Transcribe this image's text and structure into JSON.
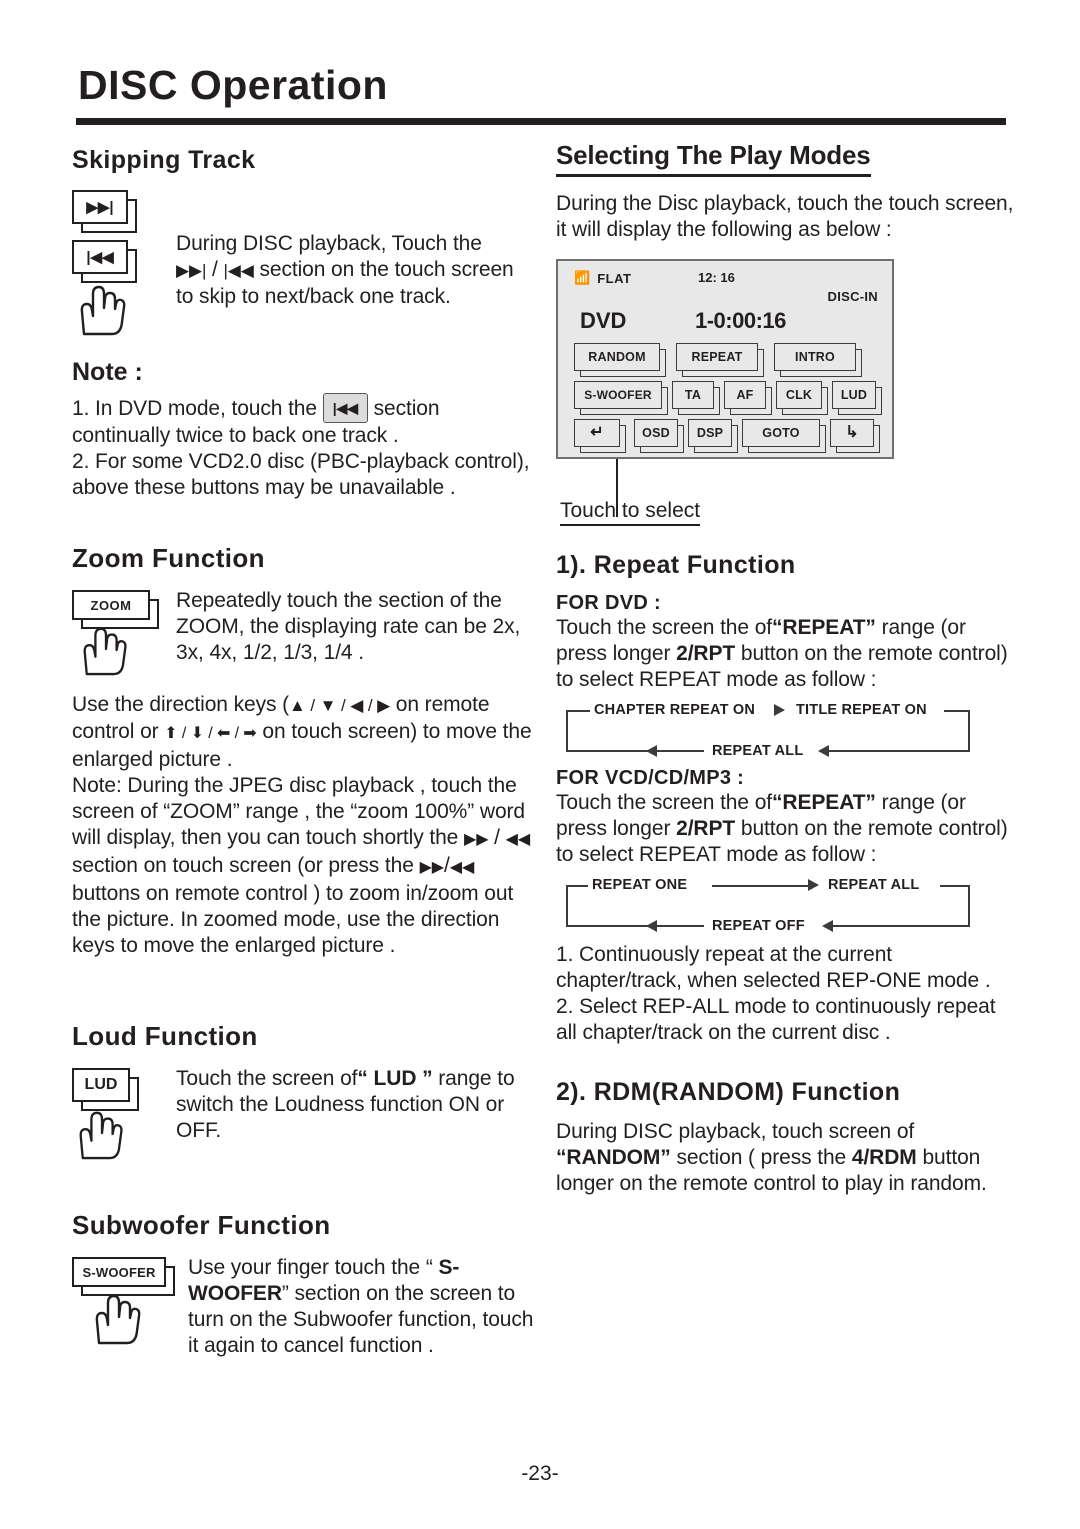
{
  "page": {
    "title": "DISC Operation",
    "number": "-23-"
  },
  "left": {
    "skipping": {
      "heading": "Skipping Track",
      "icon_next": "next-track-icon",
      "icon_prev": "previous-track-icon",
      "icon_hand": "hand-pointer-icon",
      "text_line1": "During DISC playback, Touch the",
      "text_line2_pre": "",
      "next_glyph": "▶▶|",
      "prev_glyph": "|◀◀",
      "text_line2_mid": " / ",
      "text_line2_post": " section on the touch screen",
      "text_line3": "to skip to next/back one track."
    },
    "note": {
      "heading": "Note :",
      "item1_pre": "1. In DVD mode, touch the",
      "item1_button": "prev-track-button",
      "item1_post": "section",
      "item1_cont": "continually twice to back one track .",
      "item2": "2. For some VCD2.0 disc (PBC-playback control), above these buttons may be unavailable ."
    },
    "zoom": {
      "heading": "Zoom Function",
      "key_label": "ZOOM",
      "text1": "Repeatedly touch the section of the ZOOM, the displaying rate can be 2x, 3x, 4x, 1/2, 1/3, 1/4 .",
      "text2_a": "Use the direction keys (",
      "remote_keys": "▲ / ▼ / ◀ / ▶",
      "text2_b": " on remote control or ",
      "touch_keys": "⬆ / ⬇ / ⬅ / ➡",
      "text2_c": " on touch screen) to move the enlarged picture .",
      "text3_a": "Note: During the JPEG disc playback , touch the screen of  “ZOOM” range , the “zoom 100%”  word will display, then you can touch shortly  the ",
      "ff_glyph": "▶▶",
      "rew_glyph": "◀◀",
      "text3_b": " section on touch screen (or press the ",
      "text3_c": " buttons on remote control )  to zoom in/zoom out the picture. In zoomed mode, use the direction keys to move the enlarged picture ."
    },
    "loud": {
      "heading": "Loud Function",
      "key_label": "LUD",
      "text_a": "Touch the screen of",
      "text_b": "“ LUD ”",
      "text_c": " range to switch the Loudness function ON or OFF."
    },
    "subwoofer": {
      "heading": "Subwoofer Function",
      "key_label": "S-WOOFER",
      "text_a": "Use your finger touch the “ ",
      "text_b": "S-WOOFER",
      "text_c": "” section on the screen to turn on the Subwoofer function, touch it again to cancel function ."
    }
  },
  "right": {
    "heading": "Selecting The Play Modes",
    "intro": "During the Disc playback, touch the touch screen, it will display the following as below :",
    "device": {
      "bluetooth_icon": "bluetooth-icon",
      "eq_mode": "FLAT",
      "clock": "12: 16",
      "disc_status": "DISC-IN",
      "source": "DVD",
      "time": "1-0:00:16",
      "row1": [
        "RANDOM",
        "REPEAT",
        "INTRO"
      ],
      "row2": [
        "S-WOOFER",
        "TA",
        "AF",
        "CLK",
        "LUD"
      ],
      "row3": [
        "↵",
        "OSD",
        "DSP",
        "GOTO",
        "↳"
      ]
    },
    "callout": "Touch to select",
    "repeat": {
      "heading": "1). Repeat Function",
      "dvd_label": "FOR  DVD :",
      "dvd_text_a": "Touch the screen the of",
      "dvd_text_b": "“REPEAT”",
      "dvd_text_c": " range (or press longer ",
      "dvd_text_d": "2/RPT",
      "dvd_text_e": " button on the remote control) to select REPEAT mode as follow :",
      "dvd_flow": [
        "CHAPTER REPEAT ON",
        "TITLE REPEAT ON",
        "REPEAT ALL"
      ],
      "vcd_label": "FOR  VCD/CD/MP3 :",
      "vcd_flow": [
        "REPEAT ONE",
        "REPEAT ALL",
        "REPEAT OFF"
      ],
      "note1": "1. Continuously repeat at the current chapter/track, when selected REP-ONE mode .",
      "note2": "2. Select REP-ALL mode to continuously repeat  all chapter/track on the current disc ."
    },
    "random": {
      "heading": "2). RDM(RANDOM) Function",
      "text_a": "During DISC playback, touch screen of ",
      "text_b": "“RANDOM”",
      "text_c": " section ( press the ",
      "text_d": "4/RDM",
      "text_e": " button longer on the remote control to play in random."
    }
  }
}
